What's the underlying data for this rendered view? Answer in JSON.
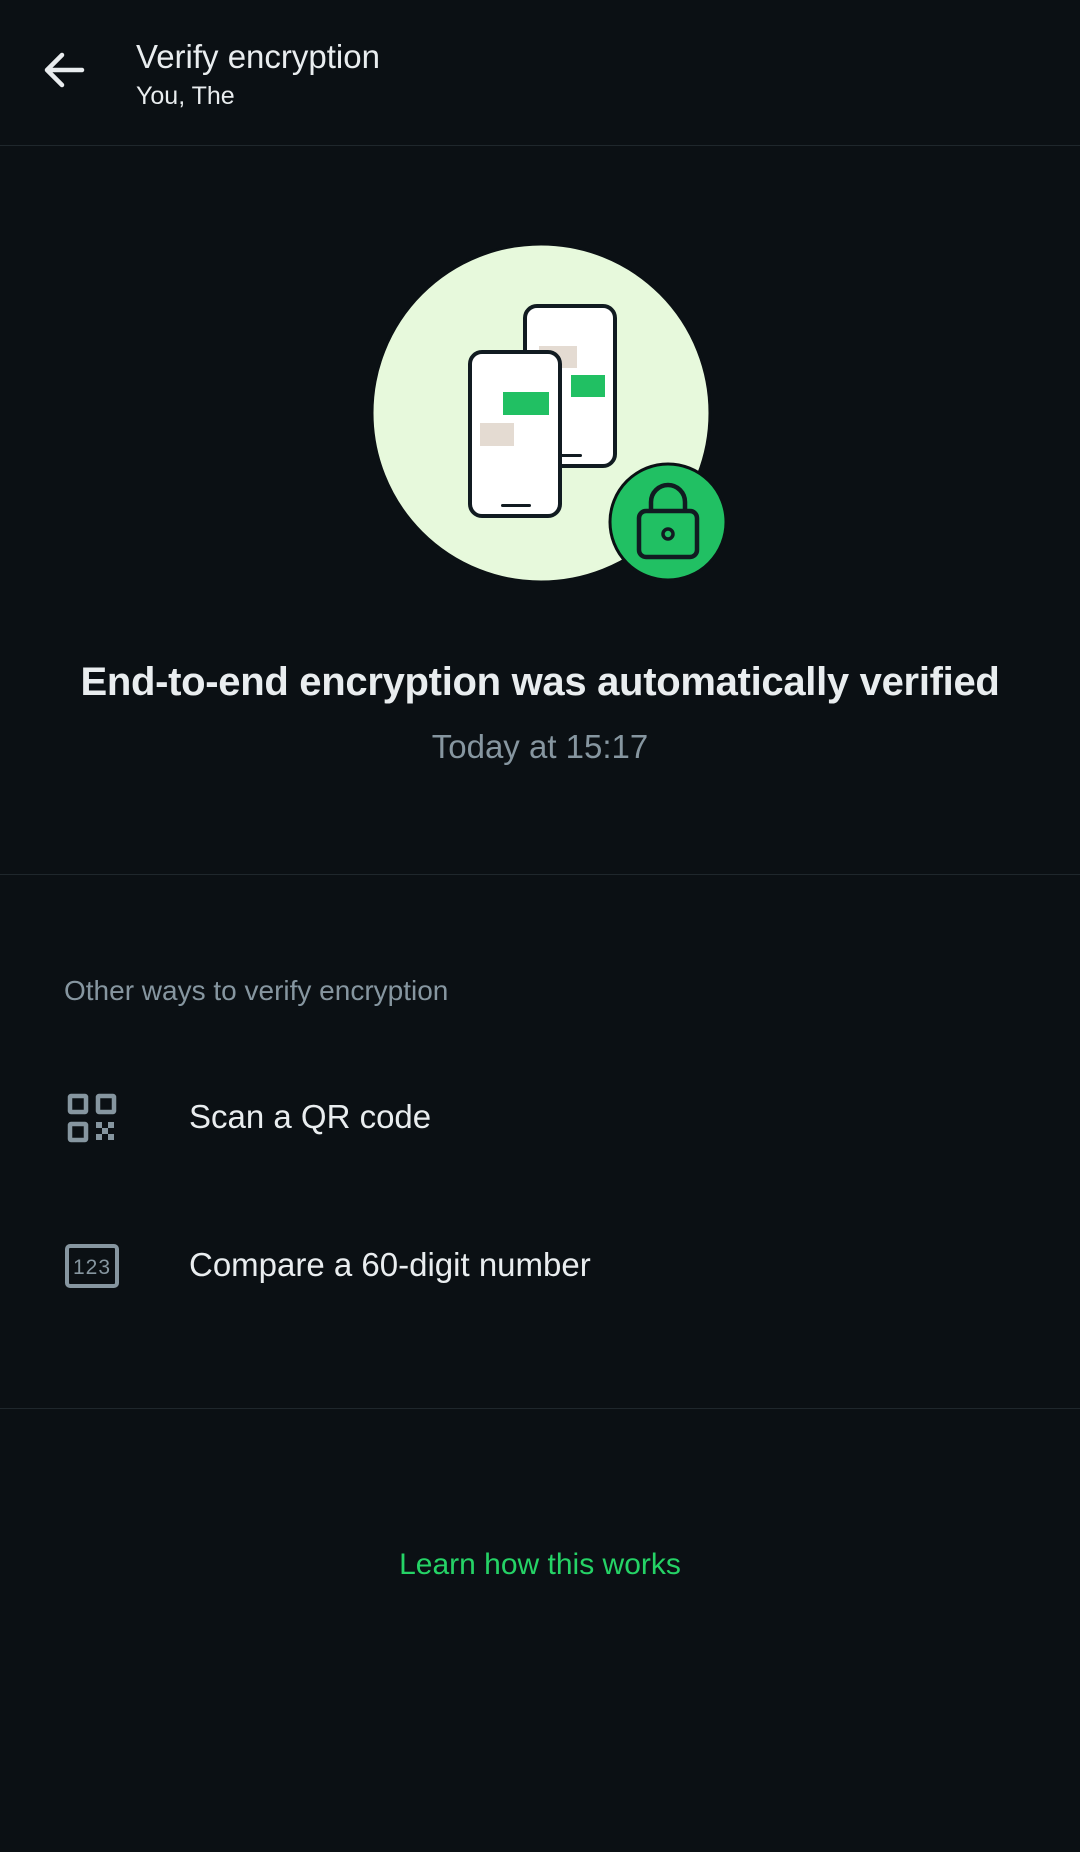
{
  "colors": {
    "background": "#0b1014",
    "accent_green": "#21c063",
    "link_green": "#25d366",
    "muted_text": "#8696a0",
    "illustration_bg": "#e7f9dc"
  },
  "header": {
    "back_icon": "arrow-left-icon",
    "title": "Verify encryption",
    "subtitle": "You, The"
  },
  "status": {
    "illustration_icon": "phones-lock-illustration",
    "title": "End-to-end encryption was automatically verified",
    "time": "Today at 15:17"
  },
  "other_ways": {
    "label": "Other ways to verify encryption",
    "options": [
      {
        "icon": "qr-code-icon",
        "label": "Scan a QR code"
      },
      {
        "icon": "number-123-icon",
        "label": "Compare a 60-digit number"
      }
    ]
  },
  "footer": {
    "learn_link": "Learn how this works"
  }
}
